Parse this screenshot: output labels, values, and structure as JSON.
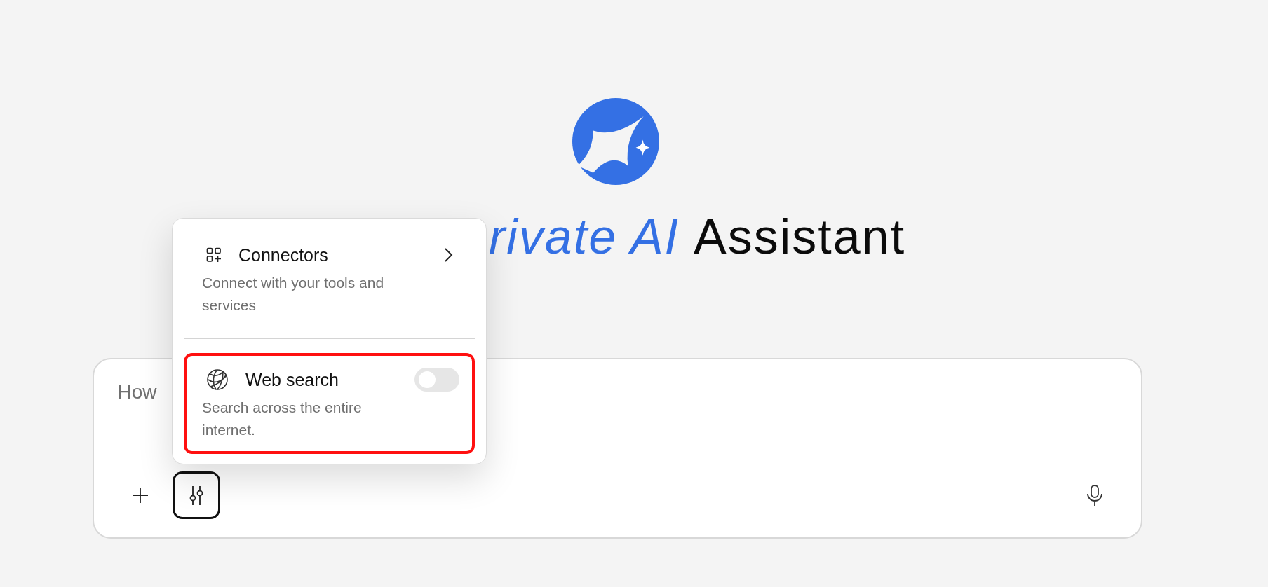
{
  "title": {
    "emphasis": "rivate AI",
    "rest": "Assistant"
  },
  "composer": {
    "placeholder": "How",
    "tools_focused": true
  },
  "menu": {
    "items": [
      {
        "kind": "link",
        "label": "Connectors",
        "description": "Connect with your tools and services",
        "highlighted": false
      },
      {
        "kind": "toggle",
        "label": "Web search",
        "description": "Search across the entire internet.",
        "on": false,
        "highlighted": true
      }
    ]
  }
}
